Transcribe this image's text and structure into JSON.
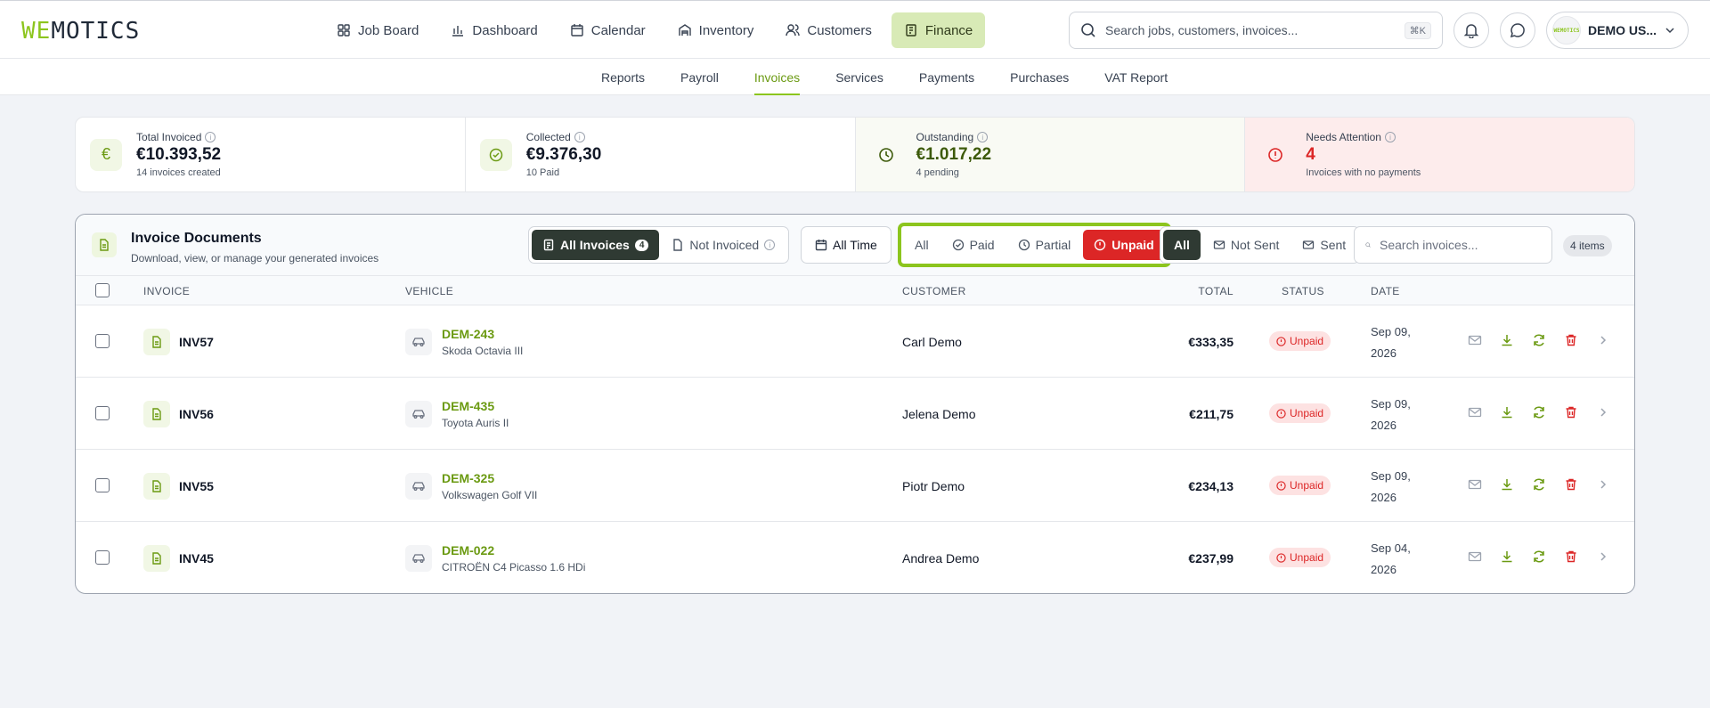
{
  "brand": {
    "logo_accent": "WE",
    "logo_rest": "MOTICS",
    "accent_color": "#8cc51e"
  },
  "nav": {
    "items": [
      {
        "label": "Job Board",
        "icon": "grid-icon"
      },
      {
        "label": "Dashboard",
        "icon": "bar-chart-icon"
      },
      {
        "label": "Calendar",
        "icon": "calendar-icon"
      },
      {
        "label": "Inventory",
        "icon": "warehouse-icon"
      },
      {
        "label": "Customers",
        "icon": "users-icon"
      },
      {
        "label": "Finance",
        "icon": "receipt-icon",
        "active": true
      }
    ],
    "search_placeholder": "Search jobs, customers, invoices...",
    "search_shortcut": "⌘K",
    "user_name": "DEMO US...",
    "avatar_text": "WEMOTICS"
  },
  "subnav": {
    "items": [
      "Reports",
      "Payroll",
      "Invoices",
      "Services",
      "Payments",
      "Purchases",
      "VAT Report"
    ],
    "active": "Invoices"
  },
  "stats": {
    "total": {
      "label": "Total Invoiced",
      "value": "€10.393,52",
      "sub": "14 invoices created",
      "icon": "euro-icon"
    },
    "collected": {
      "label": "Collected",
      "value": "€9.376,30",
      "sub": "10 Paid",
      "icon": "check-circle-icon"
    },
    "outstanding": {
      "label": "Outstanding",
      "value": "€1.017,22",
      "sub": "4 pending",
      "icon": "clock-icon"
    },
    "attention": {
      "label": "Needs Attention",
      "value": "4",
      "sub": "Invoices with no payments",
      "icon": "alert-circle-icon"
    }
  },
  "documents": {
    "title": "Invoice Documents",
    "subtitle": "Download, view, or manage your generated invoices",
    "filter_invoiced": {
      "all_label": "All Invoices",
      "all_count": "4",
      "not_label": "Not Invoiced"
    },
    "time_label": "All Time",
    "payment_filter": {
      "all": "All",
      "paid": "Paid",
      "partial": "Partial",
      "unpaid": "Unpaid"
    },
    "sent_filter": {
      "all": "All",
      "not_sent": "Not Sent",
      "sent": "Sent"
    },
    "search_placeholder": "Search invoices...",
    "item_count": "4 items",
    "columns": {
      "invoice": "INVOICE",
      "vehicle": "VEHICLE",
      "customer": "CUSTOMER",
      "total": "TOTAL",
      "status": "STATUS",
      "date": "DATE"
    },
    "rows": [
      {
        "invoice": "INV57",
        "plate": "DEM-243",
        "model": "Skoda Octavia III",
        "customer": "Carl Demo",
        "total": "€333,35",
        "status": "Unpaid",
        "date": "Sep 09, 2026"
      },
      {
        "invoice": "INV56",
        "plate": "DEM-435",
        "model": "Toyota Auris II",
        "customer": "Jelena Demo",
        "total": "€211,75",
        "status": "Unpaid",
        "date": "Sep 09, 2026"
      },
      {
        "invoice": "INV55",
        "plate": "DEM-325",
        "model": "Volkswagen Golf VII",
        "customer": "Piotr Demo",
        "total": "€234,13",
        "status": "Unpaid",
        "date": "Sep 09, 2026"
      },
      {
        "invoice": "INV45",
        "plate": "DEM-022",
        "model": "CITROËN C4 Picasso 1.6 HDi",
        "customer": "Andrea Demo",
        "total": "€237,99",
        "status": "Unpaid",
        "date": "Sep 04, 2026"
      }
    ]
  }
}
